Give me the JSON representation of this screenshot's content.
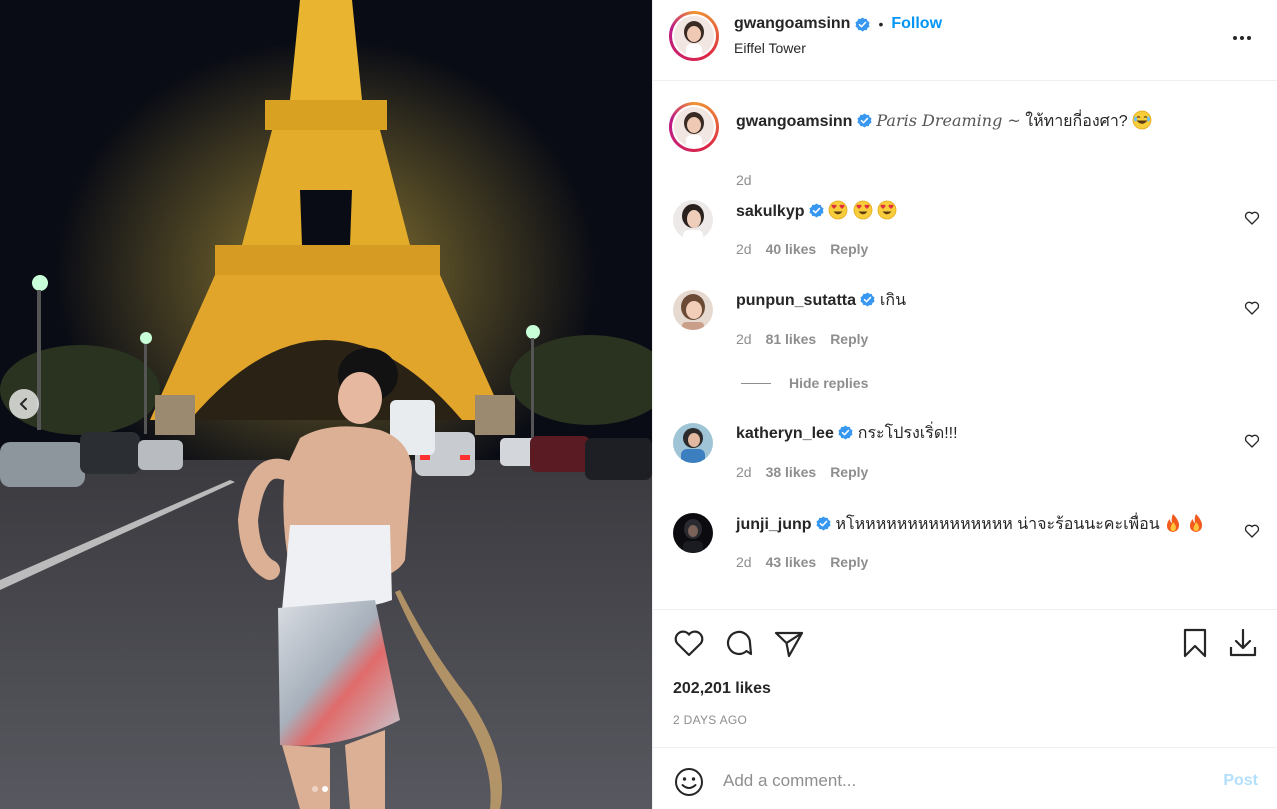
{
  "post": {
    "username": "gwangoamsinn",
    "follow_label": "Follow",
    "separator": "•",
    "location": "Eiffel Tower"
  },
  "caption": {
    "username": "gwangoamsinn",
    "text_styled": "Paris Dreaming ~",
    "text_thai": "ให้ทายกี่องศา?",
    "time": "2d"
  },
  "comments": [
    {
      "username": "sakulkyp",
      "text": "",
      "emoji": [
        "heart-eyes",
        "heart-eyes",
        "heart-eyes"
      ],
      "time": "2d",
      "likes": "40 likes",
      "reply": "Reply"
    },
    {
      "username": "punpun_sutatta",
      "text": "เกิน",
      "emoji": [],
      "time": "2d",
      "likes": "81 likes",
      "reply": "Reply"
    },
    {
      "username": "katheryn_lee",
      "text": "กระโปรงเริ่ด!!!",
      "emoji": [],
      "time": "2d",
      "likes": "38 likes",
      "reply": "Reply"
    },
    {
      "username": "junji_junp",
      "text": "หโหหหหหหหหหหหหหหห น่าจะร้อนนะคะเพื่อน",
      "emoji": [
        "fire",
        "fire"
      ],
      "time": "2d",
      "likes": "43 likes",
      "reply": "Reply"
    }
  ],
  "hide_replies": "Hide replies",
  "likes_count": "202,201 likes",
  "posted_time": "2 DAYS AGO",
  "comment_box": {
    "placeholder": "Add a comment...",
    "post_label": "Post"
  },
  "carousel": {
    "total": 2,
    "current": 2
  },
  "colors": {
    "follow": "#0095f6",
    "verified": "#3897f0",
    "muted": "#8e8e8e",
    "post_disabled": "#b2dffc"
  }
}
